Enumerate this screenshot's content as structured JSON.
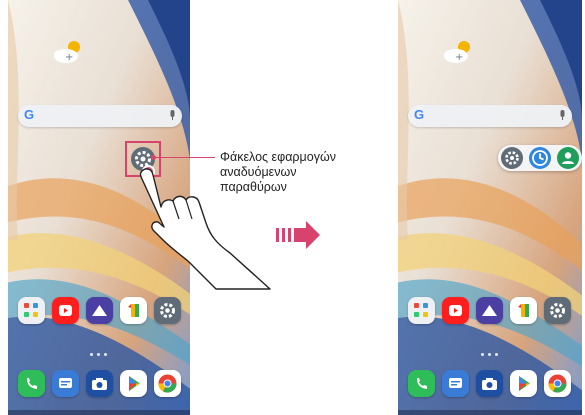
{
  "colors": {
    "highlight": "#d8436e",
    "settings_icon_bg": "#5f6b77",
    "popup_clock_bg": "#2f86de",
    "popup_contacts_bg": "#1f9e5b"
  },
  "callout": {
    "label": "Φάκελος εφαρμογών αναδυόμενων παραθύρων"
  },
  "left_phone": {
    "search_bar": {
      "logo": "G"
    },
    "folder_icon": "settings-gear-icon",
    "app_row_icons": [
      "grid-folder-icon",
      "youtube-icon",
      "gallery-icon",
      "one-app-icon",
      "settings-icon"
    ],
    "dock_icons": [
      "phone-icon",
      "messages-icon",
      "camera-icon",
      "play-store-icon",
      "chrome-icon"
    ]
  },
  "right_phone": {
    "search_bar": {
      "logo": "G"
    },
    "popup_icons": [
      "settings-icon",
      "clock-icon",
      "contacts-icon"
    ],
    "app_row_icons": [
      "grid-folder-icon",
      "youtube-icon",
      "gallery-icon",
      "one-app-icon",
      "settings-icon"
    ],
    "dock_icons": [
      "phone-icon",
      "messages-icon",
      "camera-icon",
      "play-store-icon",
      "chrome-icon"
    ]
  },
  "transition_arrow": "right-arrow-icon"
}
